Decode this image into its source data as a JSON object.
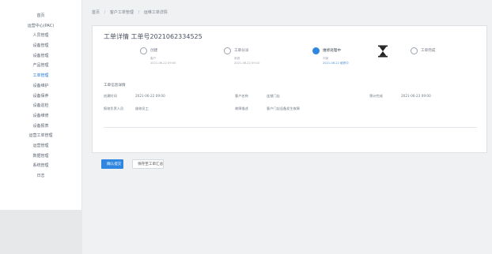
{
  "sidebar": {
    "items": [
      {
        "label": "首页"
      },
      {
        "label": "运营中心(PAC)"
      },
      {
        "label": "人员管理"
      },
      {
        "label": "设备管理"
      },
      {
        "label": "设备管理"
      },
      {
        "label": "产品管理"
      },
      {
        "label": "工单管理"
      },
      {
        "label": "设备维护"
      },
      {
        "label": "设备保养"
      },
      {
        "label": "设备巡检"
      },
      {
        "label": "设备维修"
      },
      {
        "label": "设备报表"
      },
      {
        "label": "运营工单管理"
      },
      {
        "label": "运营管理"
      },
      {
        "label": "数据管理"
      },
      {
        "label": "系统管理"
      },
      {
        "label": "日志"
      }
    ]
  },
  "breadcrumb": {
    "items": [
      "首页",
      "客户工单管理",
      "运维工单详情"
    ],
    "separator": "/"
  },
  "ticket": {
    "title": "工单详情 工单号2021062334525"
  },
  "steps": [
    {
      "name": "创建",
      "meta1": "客户",
      "meta2": "2021-06-22 09:00",
      "state": "done"
    },
    {
      "name": "工单分派",
      "meta1": "系统",
      "meta2": "2021-06-22 09:10",
      "state": "done"
    },
    {
      "name": "维修处理中",
      "meta1": "刘某",
      "meta2": "2021-06-22 维修中",
      "state": "active"
    },
    {
      "name": "工单完成",
      "meta1": "",
      "meta2": "",
      "state": "pending"
    }
  ],
  "info": {
    "section_label": "工单信息详情",
    "rows": [
      [
        {
          "k": "创建时间",
          "v": "2021-06-22 09:00"
        },
        {
          "k": "客户名称",
          "v": "连锁门店"
        },
        {
          "k": "预计完成",
          "v": "2021-06-23 09:00"
        }
      ],
      [
        {
          "k": "报修负责人员",
          "v": "维修员工"
        },
        {
          "k": "故障描述",
          "v": "客户门店设备发生故障"
        }
      ]
    ]
  },
  "actions": {
    "primary_label": "确认提交",
    "secondary_label": "保存至工单汇总"
  },
  "colors": {
    "accent": "#2f86e0",
    "sidebar_bg": "#ffffff",
    "page_bg": "#eff1f3"
  }
}
